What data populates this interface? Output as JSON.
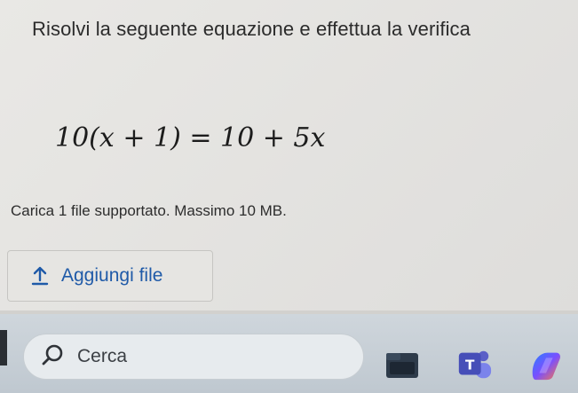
{
  "question": {
    "title": "Risolvi la seguente equazione e effettua la verifica",
    "equation": "10(x + 1) = 10 + 5x"
  },
  "upload": {
    "note": "Carica 1 file supportato. Massimo 10 MB.",
    "button_label": "Aggiungi file",
    "icon": "upload-icon"
  },
  "taskbar": {
    "search_placeholder": "Cerca",
    "search_icon": "search-icon",
    "apps": [
      {
        "name": "file-explorer-icon"
      },
      {
        "name": "teams-icon",
        "letter": "T"
      },
      {
        "name": "copilot-icon"
      }
    ]
  },
  "colors": {
    "accent": "#1f5aa8",
    "background": "#e4e3e0",
    "taskbar": "#c7cfd6"
  }
}
